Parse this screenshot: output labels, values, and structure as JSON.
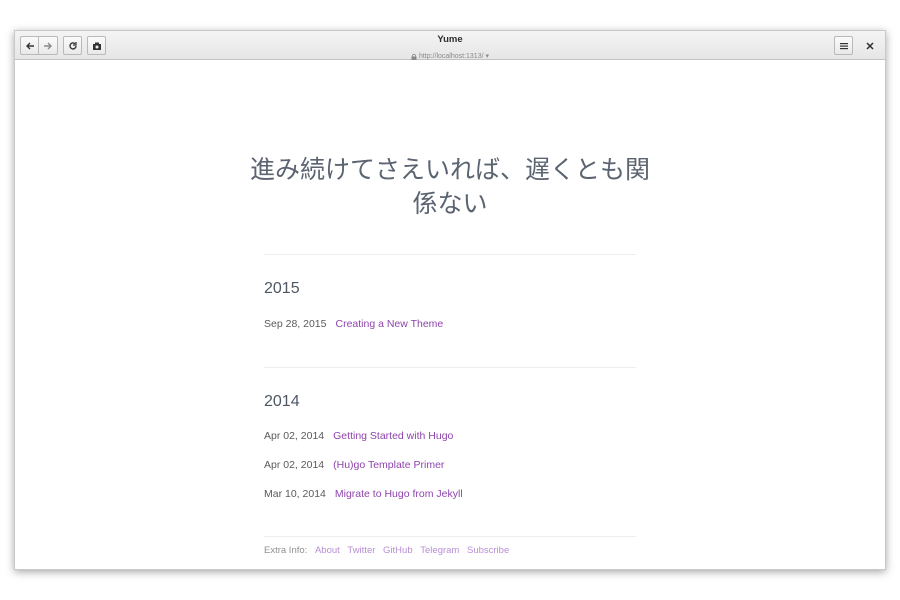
{
  "window": {
    "title": "Yume",
    "url": "http://localhost:1313/",
    "url_dropdown": "▾"
  },
  "icons": {
    "back": "arrow-left-icon",
    "forward": "arrow-right-icon",
    "reload": "reload-icon",
    "screenshot": "camera-icon",
    "menu": "hamburger-menu-icon",
    "close": "close-icon",
    "lock": "lock-icon"
  },
  "site": {
    "title": "進み続けてさえいれば、遅くとも関係ない"
  },
  "archive": [
    {
      "year": "2015",
      "posts": [
        {
          "date": "Sep 28, 2015",
          "title": "Creating a New Theme"
        }
      ]
    },
    {
      "year": "2014",
      "posts": [
        {
          "date": "Apr 02, 2014",
          "title": "Getting Started with Hugo"
        },
        {
          "date": "Apr 02, 2014",
          "title": "(Hu)go Template Primer"
        },
        {
          "date": "Mar 10, 2014",
          "title": "Migrate to Hugo from Jekyll"
        }
      ]
    }
  ],
  "footer": {
    "label": "Extra Info:",
    "links": [
      "About",
      "Twitter",
      "GitHub",
      "Telegram",
      "Subscribe"
    ]
  },
  "colors": {
    "accent_link": "#8e44ad",
    "footer_link": "#b98ed6",
    "title_text": "#5b6470"
  }
}
